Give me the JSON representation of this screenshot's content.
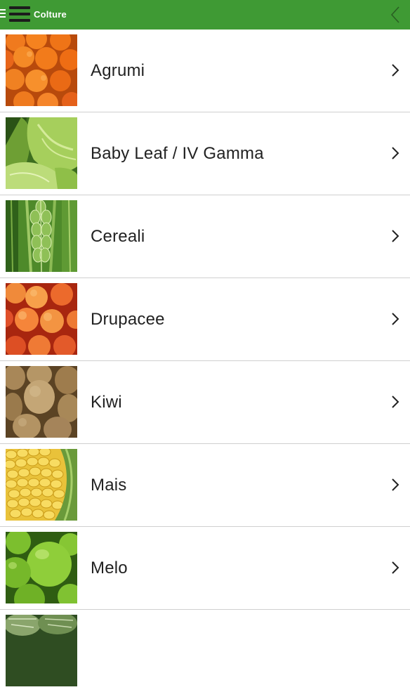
{
  "appbar": {
    "title": "Colture",
    "menu_icon": "hamburger-menu-icon",
    "back_icon": "chevron-left-icon",
    "color": "#3f9a34"
  },
  "list": {
    "items": [
      {
        "label": "Agrumi",
        "image": "oranges"
      },
      {
        "label": "Baby Leaf / IV Gamma",
        "image": "lettuce"
      },
      {
        "label": "Cereali",
        "image": "wheat"
      },
      {
        "label": "Drupacee",
        "image": "apricots"
      },
      {
        "label": "Kiwi",
        "image": "kiwi"
      },
      {
        "label": "Mais",
        "image": "corn"
      },
      {
        "label": "Melo",
        "image": "green-apples"
      },
      {
        "label": "",
        "image": "melons"
      }
    ],
    "chevron_icon": "chevron-right-icon"
  }
}
